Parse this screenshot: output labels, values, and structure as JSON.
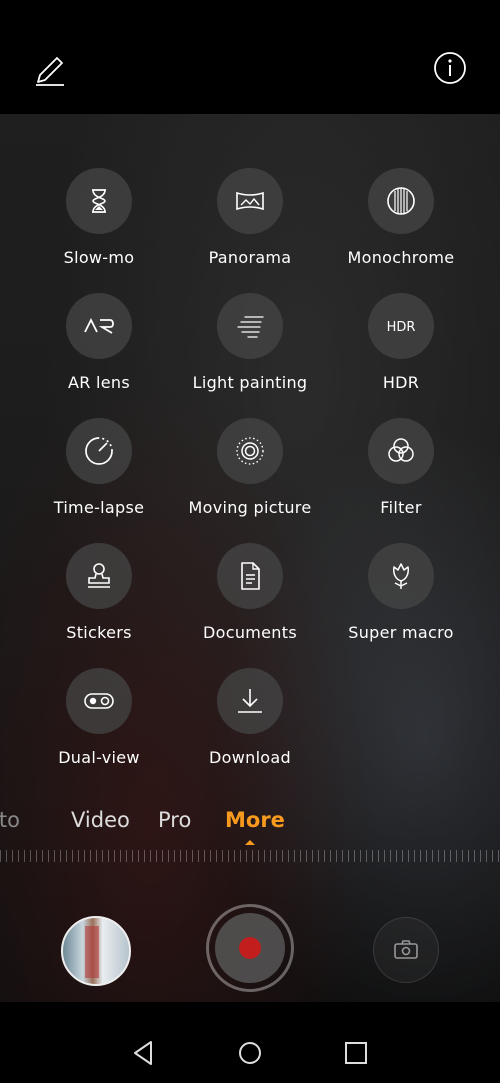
{
  "top_bar": {
    "edit_icon": "pencil-icon",
    "info_icon": "info-icon"
  },
  "modes": [
    {
      "label": "Slow-mo",
      "icon": "hourglass-icon"
    },
    {
      "label": "Panorama",
      "icon": "panorama-icon"
    },
    {
      "label": "Monochrome",
      "icon": "monochrome-icon"
    },
    {
      "label": "AR lens",
      "icon": "ar-icon"
    },
    {
      "label": "Light painting",
      "icon": "light-painting-icon"
    },
    {
      "label": "HDR",
      "icon": "hdr-icon"
    },
    {
      "label": "Time-lapse",
      "icon": "time-lapse-icon"
    },
    {
      "label": "Moving picture",
      "icon": "moving-picture-icon"
    },
    {
      "label": "Filter",
      "icon": "filter-icon"
    },
    {
      "label": "Stickers",
      "icon": "stamp-icon"
    },
    {
      "label": "Documents",
      "icon": "document-icon"
    },
    {
      "label": "Super macro",
      "icon": "flower-icon"
    },
    {
      "label": "Dual-view",
      "icon": "dual-view-icon"
    },
    {
      "label": "Download",
      "icon": "download-icon"
    }
  ],
  "hdr_icon_text": "HDR",
  "ar_icon_text": "AR",
  "mode_tabs": {
    "photo": "oto",
    "video": "Video",
    "pro": "Pro",
    "more": "More"
  },
  "colors": {
    "accent": "#f79a1e",
    "shutter_dot": "#c21e1e"
  },
  "bottom_controls": {
    "gallery_thumbnail": "gallery-thumbnail",
    "shutter": "shutter-button",
    "switch_camera": "switch-camera-icon"
  },
  "nav_bar": {
    "back": "back-icon",
    "home": "home-icon",
    "recent": "recent-apps-icon"
  }
}
